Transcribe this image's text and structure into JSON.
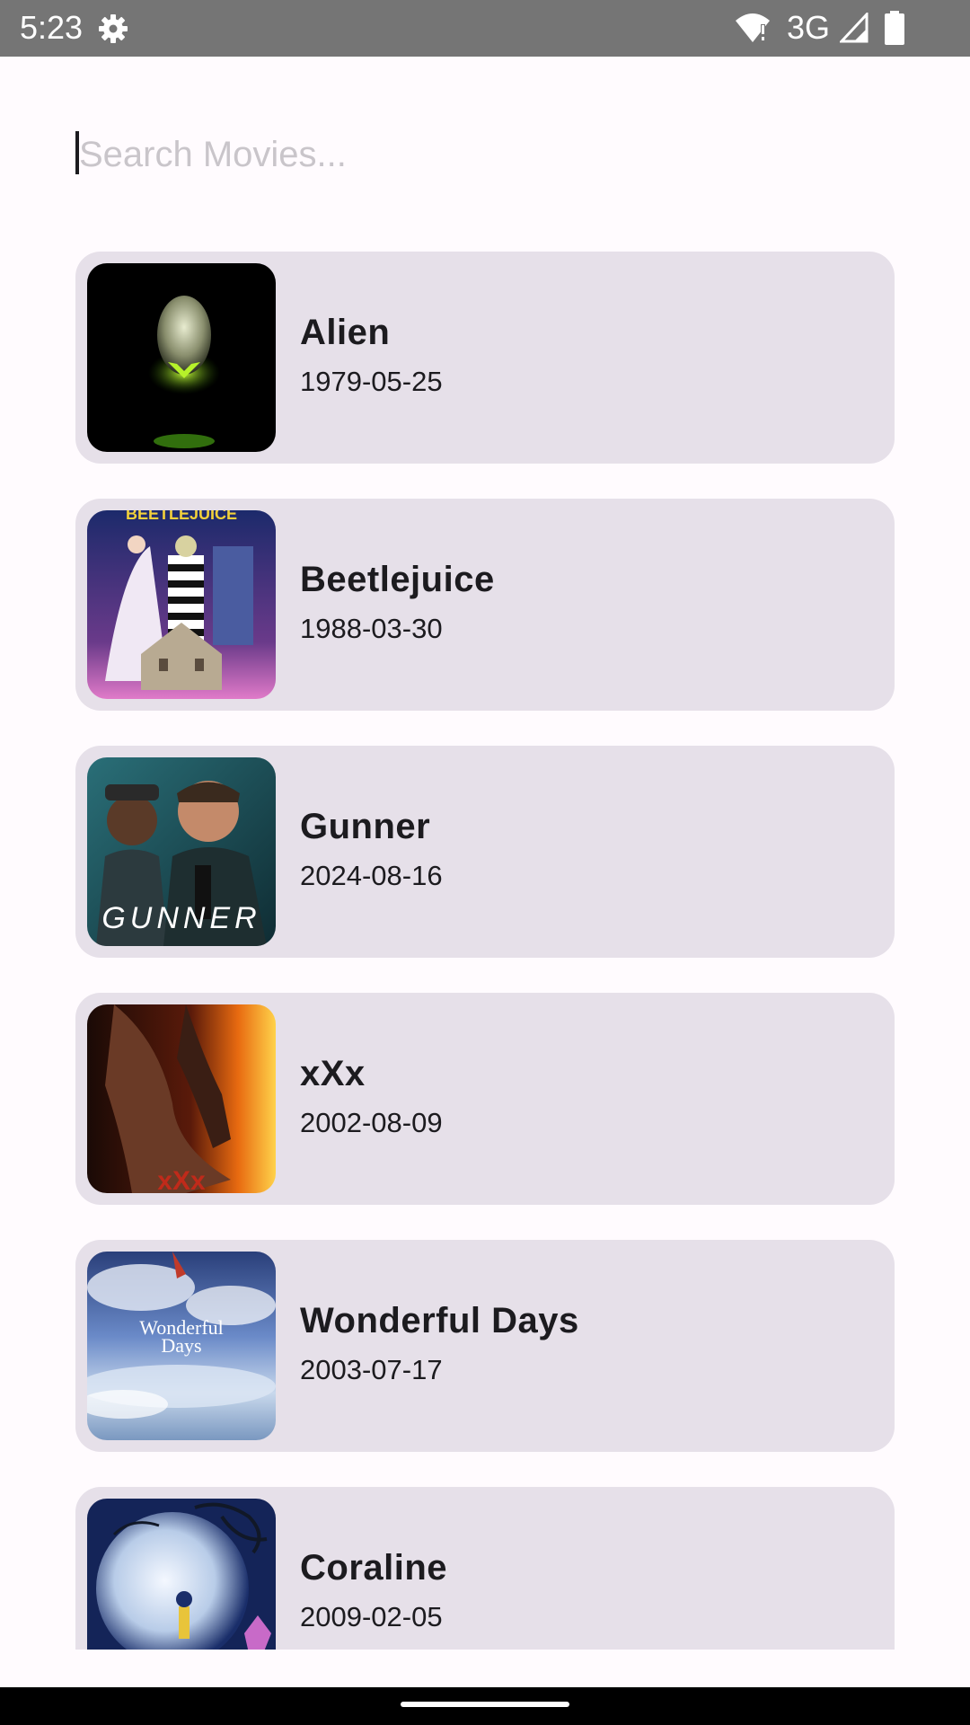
{
  "status_bar": {
    "time": "5:23",
    "network": "3G",
    "icons": [
      "gear-icon",
      "wifi-icon",
      "signal-icon",
      "battery-icon"
    ]
  },
  "search": {
    "placeholder": "Search Movies...",
    "value": ""
  },
  "movies": [
    {
      "title": "Alien",
      "date": "1979-05-25"
    },
    {
      "title": "Beetlejuice",
      "date": "1988-03-30",
      "poster_text": "BEETLEJUICE"
    },
    {
      "title": "Gunner",
      "date": "2024-08-16",
      "poster_text": "GUNNER"
    },
    {
      "title": "xXx",
      "date": "2002-08-09",
      "poster_text": "xXx"
    },
    {
      "title": "Wonderful Days",
      "date": "2003-07-17",
      "poster_text_1": "Wonderful",
      "poster_text_2": "Days"
    },
    {
      "title": "Coraline",
      "date": "2009-02-05"
    }
  ],
  "colors": {
    "background": "#fffbfe",
    "card": "#e6e0e9",
    "status_bar": "#757575",
    "placeholder": "#c9c5ca",
    "text": "#1c1b1f"
  }
}
